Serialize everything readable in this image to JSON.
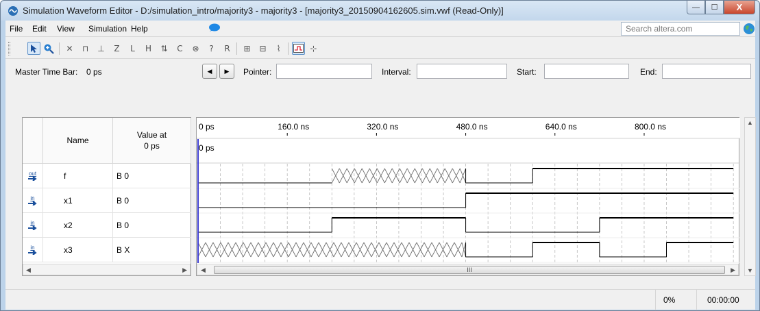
{
  "window": {
    "title": "Simulation Waveform Editor - D:/simulation_intro/majority3 - majority3 - [majority3_20150904162605.sim.vwf (Read-Only)]",
    "buttons": {
      "minimize": "—",
      "maximize": "☐",
      "close": "X"
    }
  },
  "menu": {
    "items": [
      {
        "label": "File"
      },
      {
        "label": "Edit"
      },
      {
        "label": "View"
      },
      {
        "label": "Simulation"
      },
      {
        "label": "Help"
      }
    ],
    "search_placeholder": "Search altera.com"
  },
  "toolbar": {
    "icons": [
      "pointer-tool-icon",
      "zoom-tool-icon",
      "forcing-unknown-icon",
      "forcing-low-icon",
      "forcing-high-icon",
      "high-impedance-icon",
      "weak-low-icon",
      "weak-high-icon",
      "invert-icon",
      "count-value-icon",
      "clock-icon",
      "arbitrary-value-icon",
      "random-value-icon",
      "snap-to-grid-icon",
      "run-functional-icon",
      "run-timing-icon",
      "waveform-compare-icon",
      "grid-size-icon"
    ]
  },
  "controls": {
    "master_time_bar_label": "Master Time Bar:",
    "master_time_bar_value": "0 ps",
    "pointer_label": "Pointer:",
    "pointer_value": "",
    "interval_label": "Interval:",
    "interval_value": "",
    "start_label": "Start:",
    "start_value": "",
    "end_label": "End:",
    "end_value": ""
  },
  "grid": {
    "headers": {
      "name": "Name",
      "value_line1": "Value at",
      "value_line2": "0 ps"
    },
    "signals": [
      {
        "type": "out",
        "name": "f",
        "value": "B 0"
      },
      {
        "type": "in",
        "name": "x1",
        "value": "B 0"
      },
      {
        "type": "in",
        "name": "x2",
        "value": "B 0"
      },
      {
        "type": "in",
        "name": "x3",
        "value": "B X"
      }
    ]
  },
  "waveform": {
    "time_labels": [
      "0 ps",
      "160.0 ns",
      "320.0 ns",
      "480.0 ns",
      "640.0 ns",
      "800.0 ns"
    ],
    "cursor_label": "0 ps",
    "scroll_thumb_label": "III",
    "colors": {
      "trace": "#000000",
      "cursor": "#3b3bd0",
      "grid": "#b8b8b8"
    },
    "signals": [
      {
        "name": "f",
        "segments": [
          [
            "0",
            0,
            240
          ],
          [
            "X",
            240,
            480
          ],
          [
            "0",
            480,
            600
          ],
          [
            "1",
            600,
            960
          ]
        ]
      },
      {
        "name": "x1",
        "segments": [
          [
            "0",
            0,
            480
          ],
          [
            "1",
            480,
            960
          ]
        ]
      },
      {
        "name": "x2",
        "segments": [
          [
            "0",
            0,
            240
          ],
          [
            "1",
            240,
            480
          ],
          [
            "0",
            480,
            720
          ],
          [
            "1",
            720,
            960
          ]
        ]
      },
      {
        "name": "x3",
        "segments": [
          [
            "X",
            0,
            480
          ],
          [
            "0",
            480,
            600
          ],
          [
            "1",
            600,
            720
          ],
          [
            "0",
            720,
            840
          ],
          [
            "1",
            840,
            960
          ]
        ]
      }
    ]
  },
  "status": {
    "percent": "0%",
    "time": "00:00:00"
  }
}
